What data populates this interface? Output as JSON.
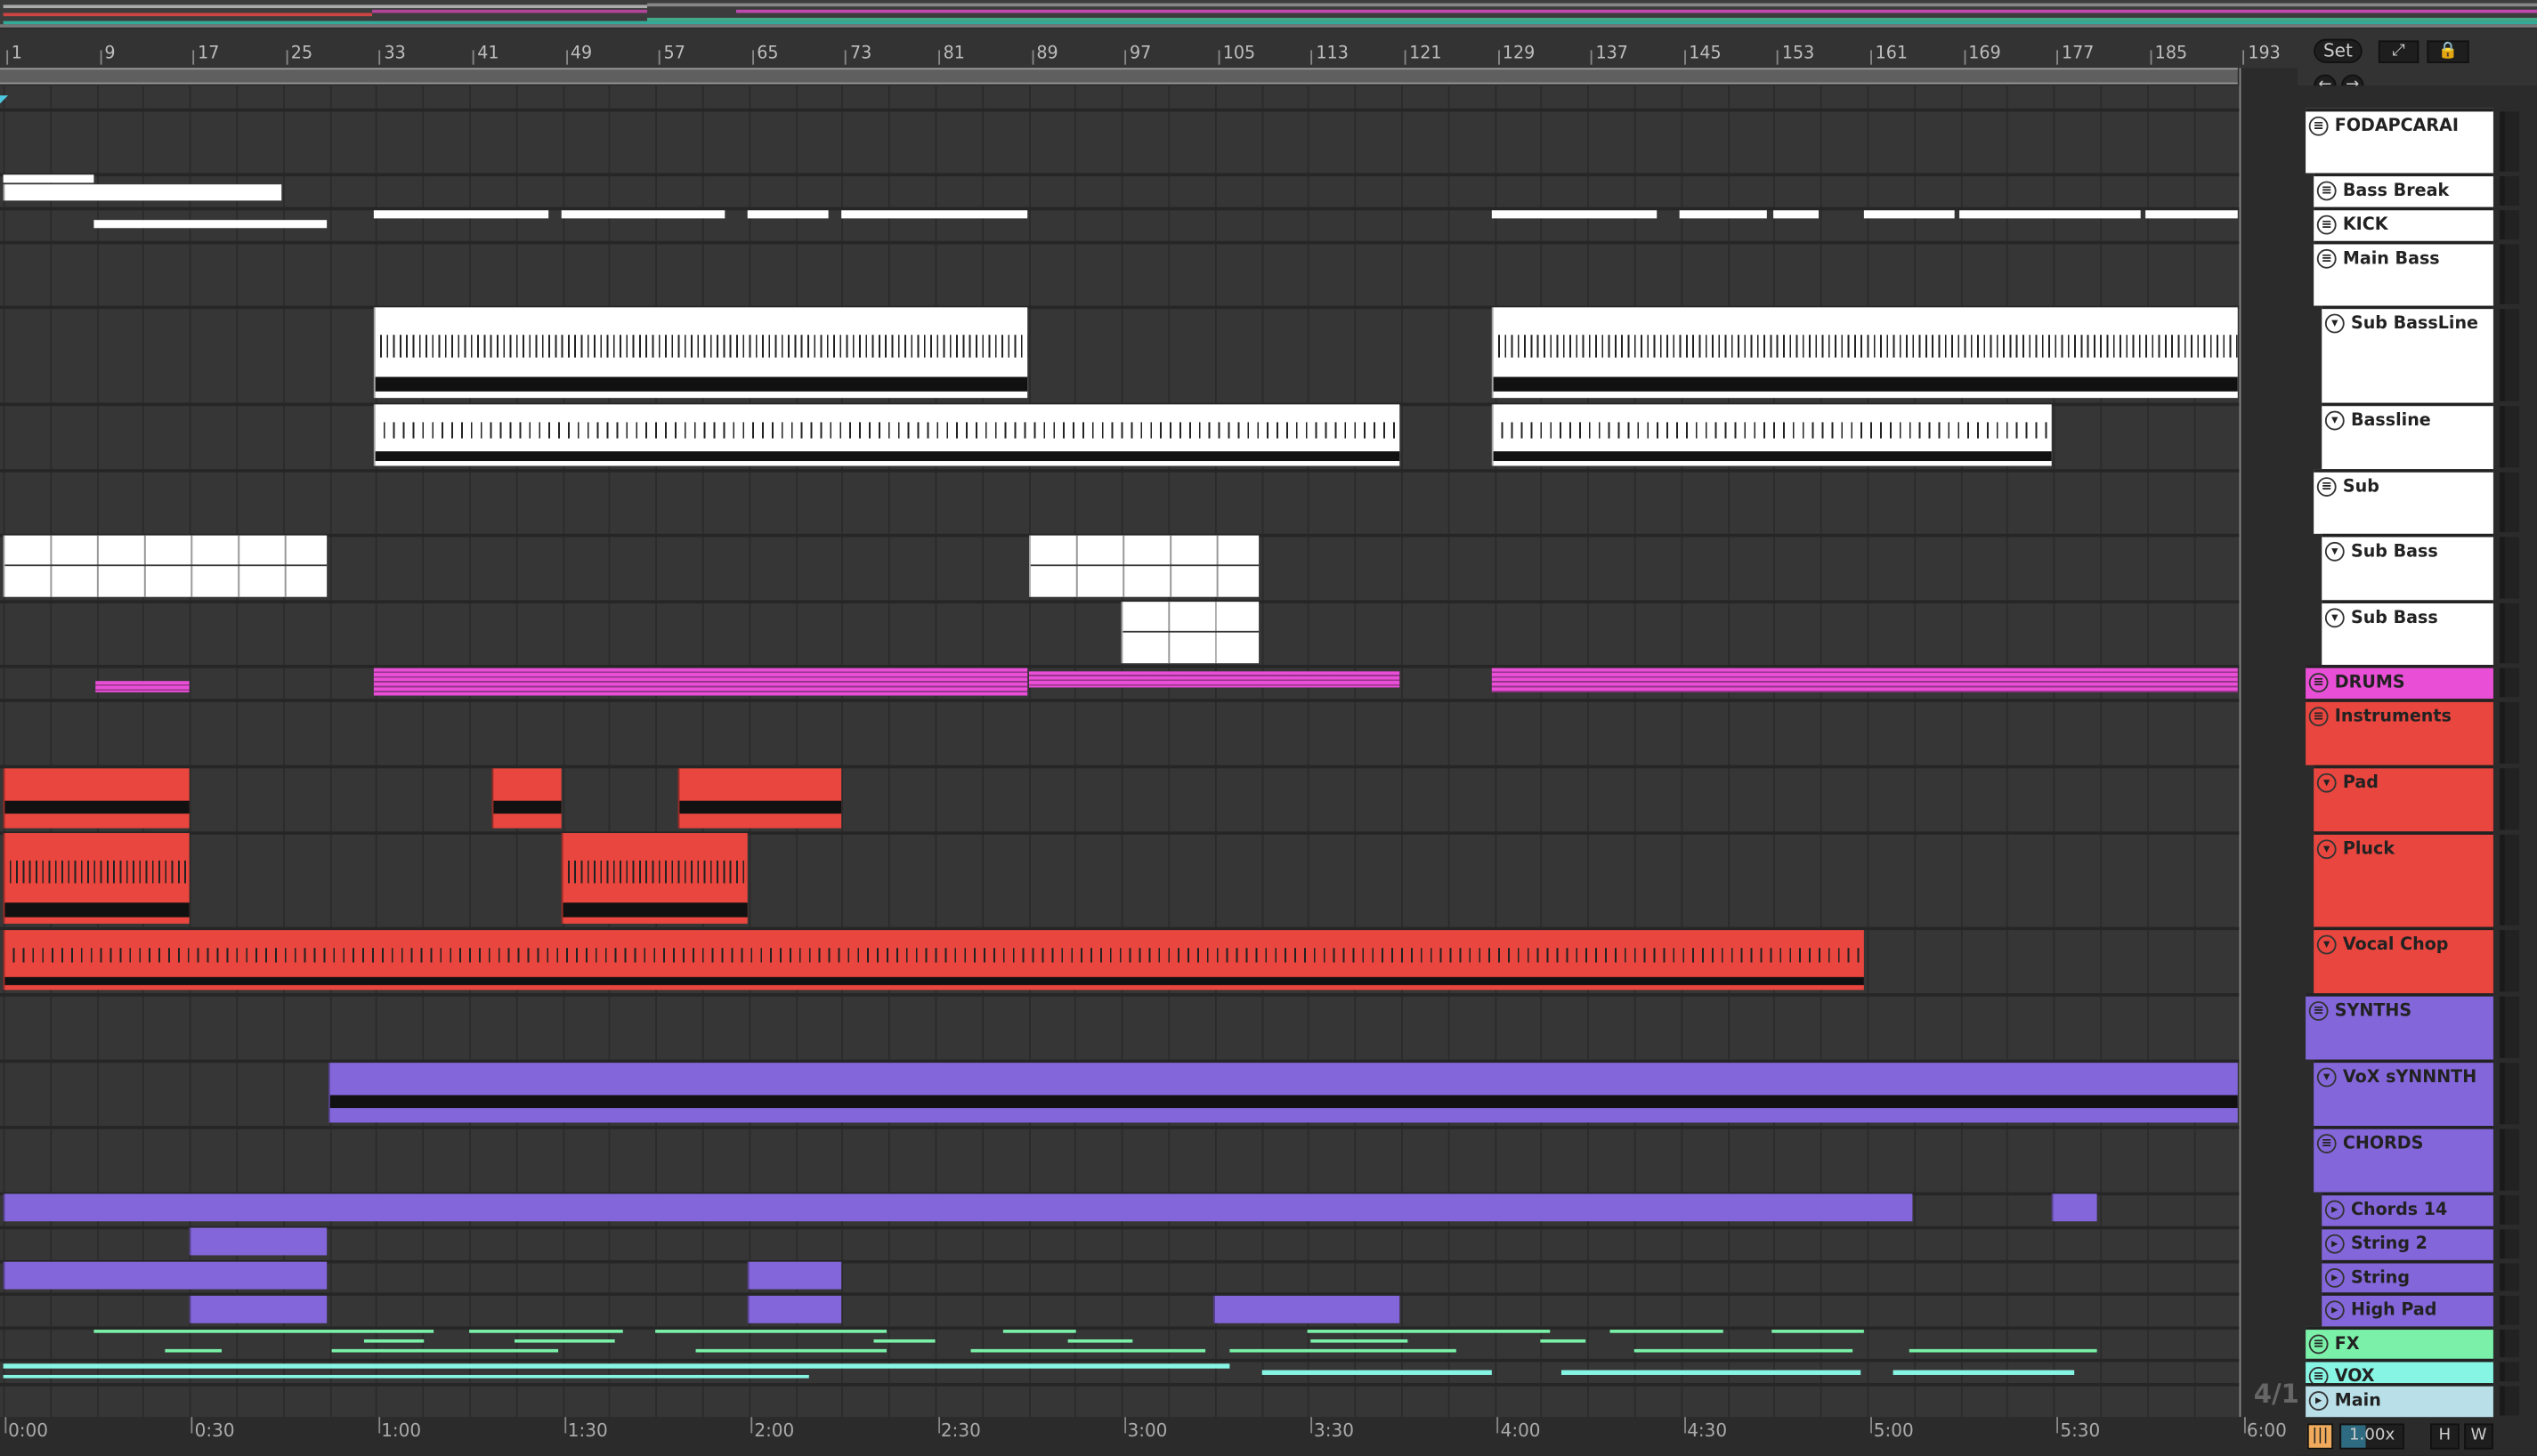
{
  "ruler": {
    "bars": [
      "1",
      "9",
      "17",
      "25",
      "33",
      "41",
      "49",
      "57",
      "65",
      "73",
      "81",
      "89",
      "97",
      "105",
      "113",
      "121",
      "129",
      "137",
      "145",
      "153",
      "161",
      "169",
      "177",
      "185",
      "193"
    ]
  },
  "timeline": {
    "labels": [
      "0:00",
      "0:30",
      "1:00",
      "1:30",
      "2:00",
      "2:30",
      "3:00",
      "3:30",
      "4:00",
      "4:30",
      "5:00",
      "5:30",
      "6:00"
    ]
  },
  "controls": {
    "set_label": "Set",
    "expand_icon": "pencil-link-icon",
    "lock_icon": "lock-icon",
    "back_icon": "arrow-left-icon",
    "forward_icon": "arrow-right-icon"
  },
  "tracks": [
    {
      "name": "FODAPCARAI",
      "icon": "group",
      "color": "#ffffff"
    },
    {
      "name": "Bass Break",
      "icon": "group",
      "color": "#ffffff"
    },
    {
      "name": "KICK",
      "icon": "group",
      "color": "#ffffff"
    },
    {
      "name": "Main Bass",
      "icon": "group",
      "color": "#ffffff"
    },
    {
      "name": "Sub BassLine",
      "icon": "midi",
      "color": "#ffffff"
    },
    {
      "name": "Bassline",
      "icon": "midi",
      "color": "#ffffff"
    },
    {
      "name": "Sub",
      "icon": "group",
      "color": "#ffffff"
    },
    {
      "name": "Sub Bass",
      "icon": "midi",
      "color": "#ffffff"
    },
    {
      "name": "Sub Bass",
      "icon": "midi",
      "color": "#ffffff"
    },
    {
      "name": "DRUMS",
      "icon": "group",
      "color": "#e84fd6"
    },
    {
      "name": "Instruments",
      "icon": "group",
      "color": "#e8463e"
    },
    {
      "name": "Pad",
      "icon": "midi",
      "color": "#e8463e"
    },
    {
      "name": "Pluck",
      "icon": "midi",
      "color": "#e8463e"
    },
    {
      "name": "Vocal Chop",
      "icon": "midi",
      "color": "#e8463e"
    },
    {
      "name": "SYNTHS",
      "icon": "group",
      "color": "#8466db"
    },
    {
      "name": "VoX sYNNNTH",
      "icon": "midi",
      "color": "#8466db"
    },
    {
      "name": "CHORDS",
      "icon": "group",
      "color": "#8466db"
    },
    {
      "name": "Chords 14",
      "icon": "audio",
      "color": "#8466db"
    },
    {
      "name": "String 2",
      "icon": "audio",
      "color": "#8466db"
    },
    {
      "name": "String",
      "icon": "audio",
      "color": "#8466db"
    },
    {
      "name": "High Pad",
      "icon": "audio",
      "color": "#8466db"
    },
    {
      "name": "FX",
      "icon": "group",
      "color": "#7af0a8"
    },
    {
      "name": "VOX",
      "icon": "group",
      "color": "#87f5e4"
    },
    {
      "name": "Main",
      "icon": "audio",
      "color": "#b9dfe8"
    }
  ],
  "status": {
    "time_signature": "4/1",
    "tempo_scale": "1.00x",
    "h_label": "H",
    "w_label": "W"
  }
}
